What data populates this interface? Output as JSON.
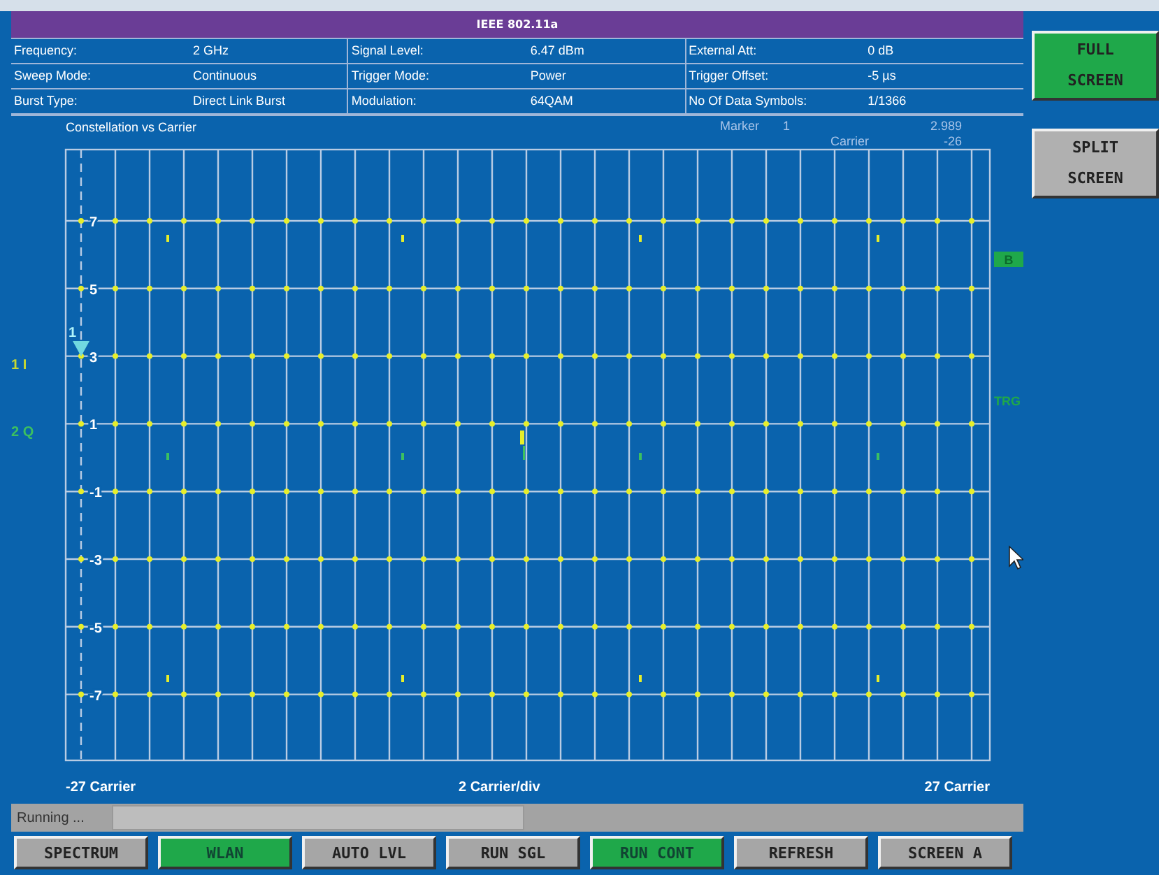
{
  "window": {
    "title": "IEEE 802.11a"
  },
  "settings": [
    {
      "label": "Frequency:",
      "value": "2 GHz"
    },
    {
      "label": "Signal Level:",
      "value": "6.47 dBm"
    },
    {
      "label": "External Att:",
      "value": "0 dB"
    },
    {
      "label": "Sweep Mode:",
      "value": "Continuous"
    },
    {
      "label": "Trigger Mode:",
      "value": "Power"
    },
    {
      "label": "Trigger Offset:",
      "value": "-5 µs"
    },
    {
      "label": "Burst Type:",
      "value": "Direct Link Burst"
    },
    {
      "label": "Modulation:",
      "value": "64QAM"
    },
    {
      "label": "No Of Data Symbols:",
      "value": "1/1366"
    }
  ],
  "plot": {
    "title": "Constellation vs Carrier",
    "marker_label": "Marker",
    "marker_number": "1",
    "marker_value": "2.989",
    "marker_unit": "Carrier",
    "marker_carrier": "-26",
    "marker_flag": "1",
    "y_labels": [
      "7",
      "5",
      "3",
      "1",
      "-1",
      "-3",
      "-5",
      "-7"
    ],
    "traces": [
      {
        "label": "1 I",
        "color": "#c8d830"
      },
      {
        "label": "2 Q",
        "color": "#3cc060"
      }
    ],
    "side_flags": [
      {
        "text": "B",
        "kind": "badge"
      },
      {
        "text": "TRG",
        "kind": "plain"
      }
    ],
    "x_start": "-27 Carrier",
    "x_scale": "2 Carrier/div",
    "x_end": "27 Carrier"
  },
  "status": {
    "text": "Running ..."
  },
  "side_buttons": [
    {
      "lines": [
        "FULL",
        "SCREEN"
      ],
      "selected": true
    },
    {
      "lines": [
        "SPLIT",
        "SCREEN"
      ],
      "selected": false
    }
  ],
  "softkeys": [
    {
      "label": "SPECTRUM",
      "selected": false
    },
    {
      "label": "WLAN",
      "selected": true
    },
    {
      "label": "AUTO LVL",
      "selected": false
    },
    {
      "label": "RUN SGL",
      "selected": false
    },
    {
      "label": "RUN CONT",
      "selected": true
    },
    {
      "label": "REFRESH",
      "selected": false
    },
    {
      "label": "SCREEN A",
      "selected": false
    }
  ]
}
